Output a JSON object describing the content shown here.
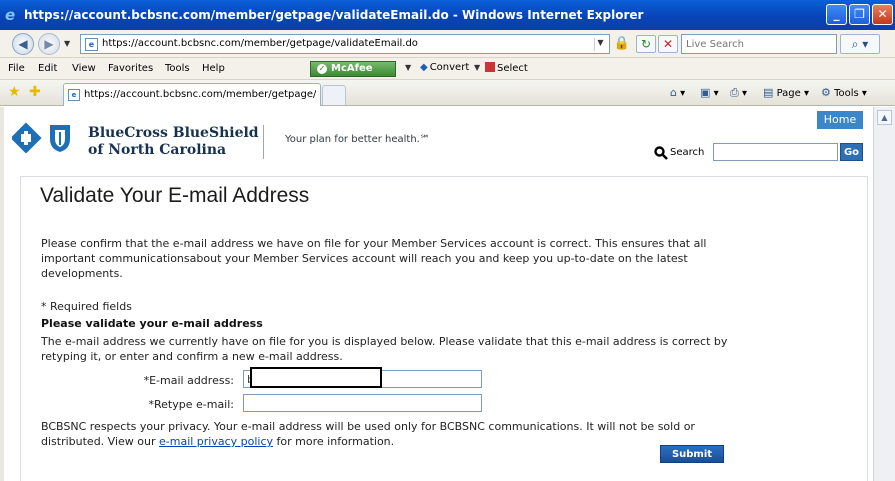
{
  "window": {
    "title": "https://account.bcbsnc.com/member/getpage/validateEmail.do - Windows Internet Explorer",
    "minimize": "_",
    "maximize": "❐",
    "close": "✕"
  },
  "addressbar": {
    "url": "https://account.bcbsnc.com/member/getpage/validateEmail.do",
    "search_placeholder": "Live Search"
  },
  "menu": {
    "items": [
      "File",
      "Edit",
      "View",
      "Favorites",
      "Tools",
      "Help"
    ],
    "mcafee": "McAfee",
    "convert": "Convert",
    "select": "Select"
  },
  "tabs": {
    "active_title": "https://account.bcbsnc.com/member/getpage/validat..."
  },
  "commandbar": {
    "page": "Page",
    "tools": "Tools"
  },
  "site": {
    "brand_line1": "BlueCross BlueShield",
    "brand_line2": "of North Carolina",
    "tagline": "Your plan for better health.℠",
    "home": "Home",
    "search_label": "Search",
    "go": "Go"
  },
  "form": {
    "title": "Validate Your E-mail Address",
    "intro": "Please confirm that the e-mail address we have on file for your Member Services account is correct. This ensures that all important communicationsabout your Member Services account will reach you and keep you up-to-date on the latest developments.",
    "required": "* Required fields",
    "subheading": "Please validate your e-mail address",
    "instructions": "The e-mail address we currently have on file for you is displayed below. Please validate that this e-mail address is correct by retyping it, or enter and confirm a new e-mail address.",
    "email_label": "*E-mail address:",
    "email_value": "b",
    "retype_label": "*Retype e-mail:",
    "privacy_before": "BCBSNC respects your privacy. Your e-mail address will be used only for BCBSNC communications. It will not be sold or distributed. View our ",
    "privacy_link": "e-mail privacy policy",
    "privacy_after": " for more information.",
    "submit": "Submit"
  }
}
